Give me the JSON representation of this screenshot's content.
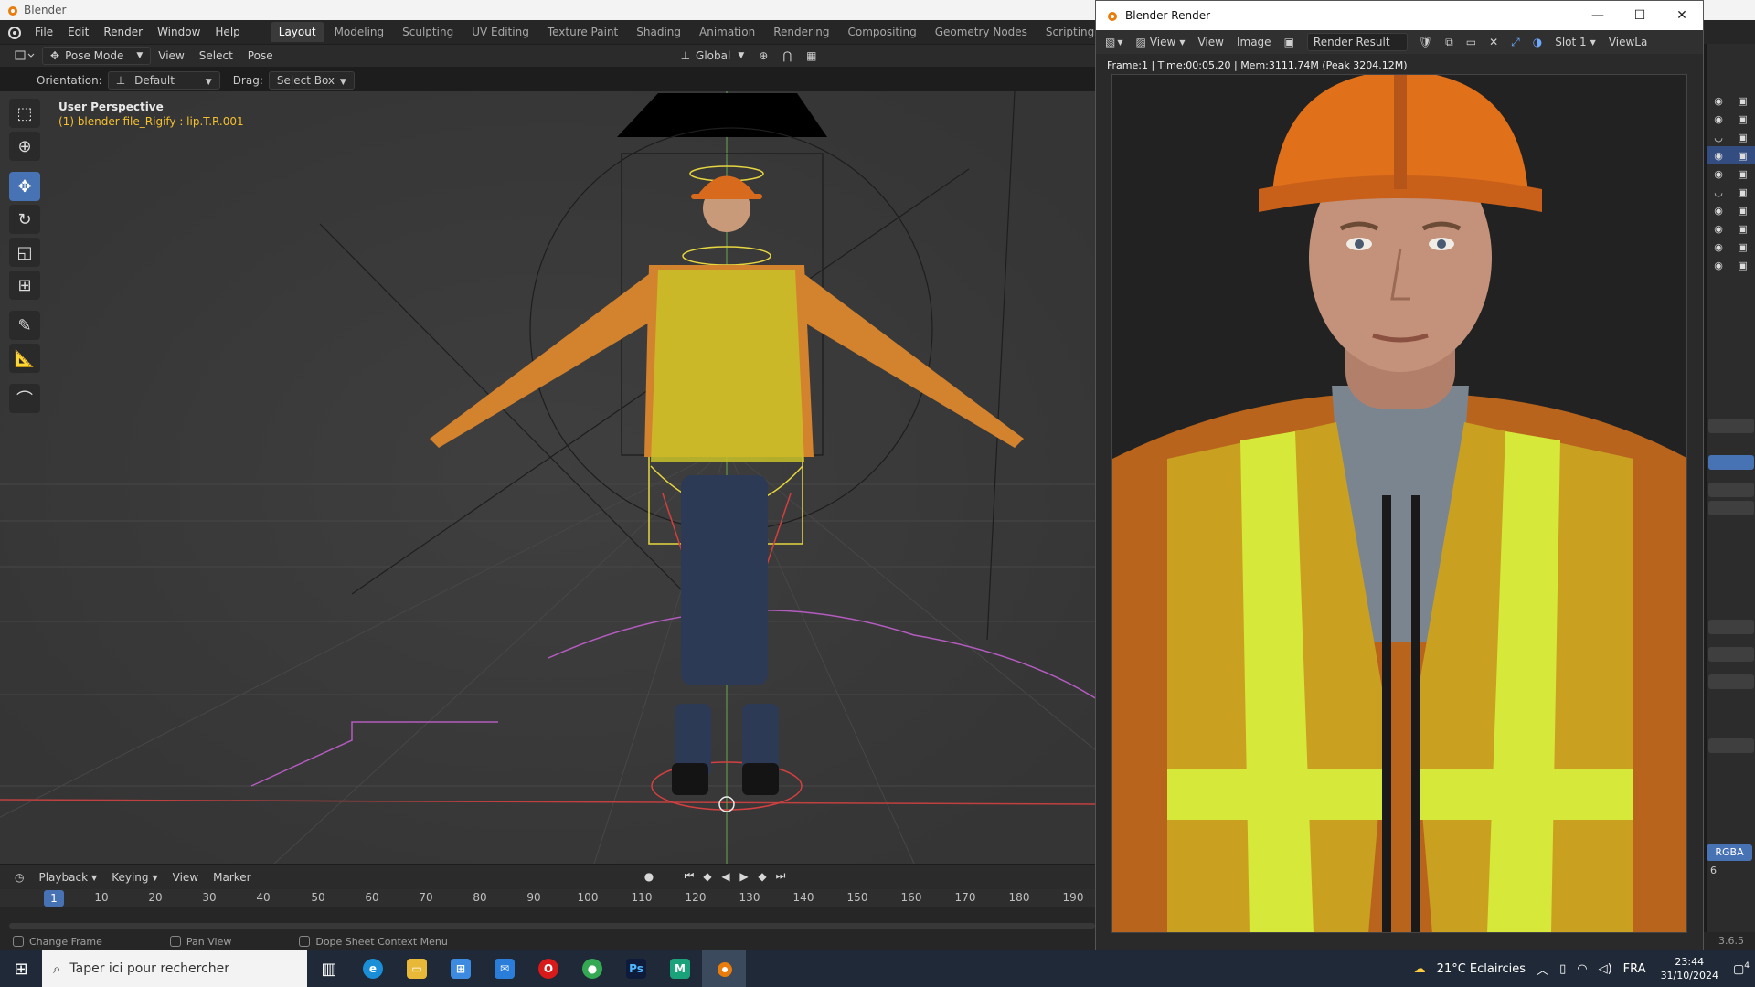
{
  "os_window_title": "Blender",
  "menus": [
    "File",
    "Edit",
    "Render",
    "Window",
    "Help"
  ],
  "workspaces": [
    "Layout",
    "Modeling",
    "Sculpting",
    "UV Editing",
    "Texture Paint",
    "Shading",
    "Animation",
    "Rendering",
    "Compositing",
    "Geometry Nodes",
    "Scripting"
  ],
  "active_workspace": "Layout",
  "viewport_header": {
    "mode": "Pose Mode",
    "items": [
      "View",
      "Select",
      "Pose"
    ],
    "transform_orientation": "Global"
  },
  "tool_settings": {
    "orientation_label": "Orientation:",
    "orientation_value": "Default",
    "drag_label": "Drag:",
    "drag_value": "Select Box"
  },
  "viewport": {
    "perspective": "User Perspective",
    "active_object": "(1) blender file_Rigify : lip.T.R.001"
  },
  "toolbar_icons": [
    "select-box-icon",
    "cursor-icon",
    "move-icon",
    "rotate-icon",
    "scale-icon",
    "transform-icon",
    "annotate-icon",
    "measure-icon",
    "relax-icon"
  ],
  "timeline": {
    "menus": [
      "Playback",
      "Keying",
      "View",
      "Marker"
    ],
    "current_frame": "1",
    "ticks": [
      "10",
      "20",
      "30",
      "40",
      "50",
      "60",
      "70",
      "80",
      "90",
      "100",
      "110",
      "120",
      "130",
      "140",
      "150",
      "160",
      "170",
      "180",
      "190"
    ]
  },
  "statusbar": {
    "items": [
      "Change Frame",
      "Pan View",
      "Dope Sheet Context Menu"
    ],
    "version": "3.6.5"
  },
  "render_window": {
    "title": "Blender Render",
    "menus": [
      "View",
      "View",
      "Image"
    ],
    "image_name": "Render Result",
    "slot": "Slot 1",
    "view_layer": "ViewLa",
    "info": "Frame:1 | Time:00:05.20 | Mem:3111.74M (Peak 3204.12M)"
  },
  "properties": {
    "rgba_label": "RGBA",
    "num_label": "6"
  },
  "taskbar": {
    "search_placeholder": "Taper ici pour rechercher",
    "weather": "21°C  Eclaircies",
    "language": "FRA",
    "time": "23:44",
    "date": "31/10/2024",
    "notif_count": "4"
  },
  "colors": {
    "accent": "#4772b3",
    "active_bone_text": "#f4c030",
    "viewport_bg": "#3c3c3c"
  }
}
